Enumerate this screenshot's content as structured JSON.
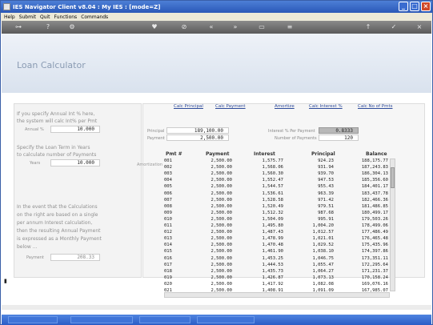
{
  "window": {
    "title": "IES Navigator Client v8.04 : My IES :      [mode=Z]"
  },
  "menu": [
    "Help",
    "Submit",
    "Quit",
    "Functions",
    "Commands"
  ],
  "app": {
    "title": "Loan Calculator"
  },
  "sidebar": {
    "annual_text": [
      "If you specify Annual Int % here,",
      "the system will calc Int% per Pmt"
    ],
    "annual_label": "Annual %",
    "annual_value": "10.000",
    "term_text": [
      "Specify the Loan Term in Years",
      "to calculate number of Payments"
    ],
    "years_label": "Years",
    "years_value": "10.000",
    "event_text": [
      "In the event that the Calculations",
      "on the right are based on a single",
      "per annum Interest calculation,",
      "then the resulting Annual Payment",
      "is expressed as a Monthly Payment",
      "below ..."
    ],
    "payment_label": "Payment",
    "payment_value": "208.33"
  },
  "links": [
    "Calc Principal",
    "Calc Payment",
    "Amortize",
    "Calc Interest %",
    "Calc No of Pmts"
  ],
  "fields": {
    "principal_label": "Principal",
    "principal_value": "189,100.00",
    "payment_label": "Payment",
    "payment_value": "2,500.00",
    "interest_label": "Interest % Per Payment",
    "interest_value": "0.8333",
    "numpayments_label": "Number of Payments",
    "numpayments_value": "120"
  },
  "amortization_label": "Amortization",
  "table": {
    "headers": [
      "Pmt #",
      "Payment",
      "Interest",
      "Principal",
      "Balance"
    ],
    "rows": [
      [
        "001",
        "2,500.00",
        "1,575.77",
        "924.23",
        "188,175.77"
      ],
      [
        "002",
        "2,500.00",
        "1,568.06",
        "931.94",
        "187,243.83"
      ],
      [
        "003",
        "2,500.00",
        "1,560.30",
        "939.70",
        "186,304.13"
      ],
      [
        "004",
        "2,500.00",
        "1,552.47",
        "947.53",
        "185,356.60"
      ],
      [
        "005",
        "2,500.00",
        "1,544.57",
        "955.43",
        "184,401.17"
      ],
      [
        "006",
        "2,500.00",
        "1,536.61",
        "963.39",
        "183,437.78"
      ],
      [
        "007",
        "2,500.00",
        "1,528.58",
        "971.42",
        "182,466.36"
      ],
      [
        "008",
        "2,500.00",
        "1,520.49",
        "979.51",
        "181,486.85"
      ],
      [
        "009",
        "2,500.00",
        "1,512.32",
        "987.68",
        "180,499.17"
      ],
      [
        "010",
        "2,500.00",
        "1,504.09",
        "995.91",
        "179,503.26"
      ],
      [
        "011",
        "2,500.00",
        "1,495.80",
        "1,004.20",
        "178,499.06"
      ],
      [
        "012",
        "2,500.00",
        "1,487.43",
        "1,012.57",
        "177,486.49"
      ],
      [
        "013",
        "2,500.00",
        "1,478.99",
        "1,021.01",
        "176,465.48"
      ],
      [
        "014",
        "2,500.00",
        "1,470.48",
        "1,029.52",
        "175,435.96"
      ],
      [
        "015",
        "2,500.00",
        "1,461.90",
        "1,038.10",
        "174,397.86"
      ],
      [
        "016",
        "2,500.00",
        "1,453.25",
        "1,046.75",
        "173,351.11"
      ],
      [
        "017",
        "2,500.00",
        "1,444.53",
        "1,055.47",
        "172,295.64"
      ],
      [
        "018",
        "2,500.00",
        "1,435.73",
        "1,064.27",
        "171,231.37"
      ],
      [
        "019",
        "2,500.00",
        "1,426.87",
        "1,073.13",
        "170,158.24"
      ],
      [
        "020",
        "2,500.00",
        "1,417.92",
        "1,082.08",
        "169,076.16"
      ],
      [
        "021",
        "2,500.00",
        "1,408.91",
        "1,091.09",
        "167,985.07"
      ]
    ]
  }
}
